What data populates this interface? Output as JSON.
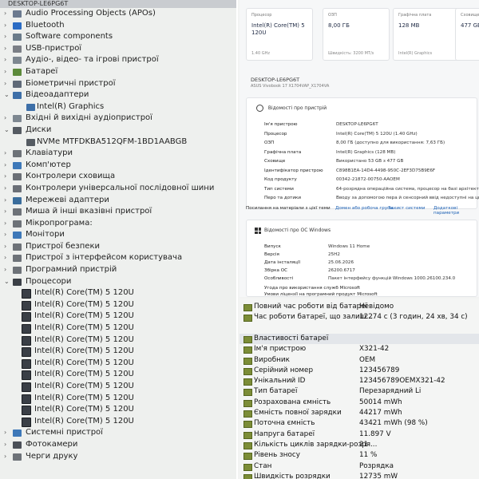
{
  "device_manager": {
    "title": "DESKTOP-LE6PG6T",
    "items": [
      {
        "label": "Audio Processing Objects (APOs)",
        "level": 0,
        "arrow": "›",
        "icon": "audio-icon",
        "color": "#6b7a8f"
      },
      {
        "label": "Bluetooth",
        "level": 0,
        "arrow": "›",
        "icon": "bluetooth-icon",
        "color": "#2b6cc4"
      },
      {
        "label": "Software components",
        "level": 0,
        "arrow": "›",
        "icon": "software-component-icon",
        "color": "#6a7b8a"
      },
      {
        "label": "USB-пристрої",
        "level": 0,
        "arrow": "›",
        "icon": "usb-icon",
        "color": "#7b7f86"
      },
      {
        "label": "Аудіо-, відео- та ігрові пристрої",
        "level": 0,
        "arrow": "›",
        "icon": "speaker-icon",
        "color": "#7d8790"
      },
      {
        "label": "Батареї",
        "level": 0,
        "arrow": "›",
        "icon": "battery-icon",
        "color": "#5c8a3a"
      },
      {
        "label": "Біометричні пристрої",
        "level": 0,
        "arrow": "›",
        "icon": "fingerprint-icon",
        "color": "#5f6a78"
      },
      {
        "label": "Відеоадаптери",
        "level": 0,
        "arrow": "⌄",
        "icon": "display-adapter-icon",
        "color": "#3d6fa8"
      },
      {
        "label": "Intel(R) Graphics",
        "level": 1,
        "arrow": "",
        "icon": "display-adapter-icon",
        "color": "#3d6fa8"
      },
      {
        "label": "Вхідні й вихідні аудіопристрої",
        "level": 0,
        "arrow": "›",
        "icon": "audio-io-icon",
        "color": "#7d8790"
      },
      {
        "label": "Диски",
        "level": 0,
        "arrow": "⌄",
        "icon": "disk-drive-icon",
        "color": "#555b62"
      },
      {
        "label": "NVMe MTFDKBA512QFM-1BD1AABGB",
        "level": 1,
        "arrow": "",
        "icon": "disk-drive-icon",
        "color": "#555b62"
      },
      {
        "label": "Клавіатури",
        "level": 0,
        "arrow": "›",
        "icon": "keyboard-icon",
        "color": "#6d7278"
      },
      {
        "label": "Комп'ютер",
        "level": 0,
        "arrow": "›",
        "icon": "computer-icon",
        "color": "#3d78b8"
      },
      {
        "label": "Контролери сховища",
        "level": 0,
        "arrow": "›",
        "icon": "storage-controller-icon",
        "color": "#6a6f76"
      },
      {
        "label": "Контролери універсальної послідовної шини",
        "level": 0,
        "arrow": "›",
        "icon": "usb-controller-icon",
        "color": "#6a6f76"
      },
      {
        "label": "Мережеві адаптери",
        "level": 0,
        "arrow": "›",
        "icon": "network-adapter-icon",
        "color": "#3a6d9c"
      },
      {
        "label": "Миша й інші вказівні пристрої",
        "level": 0,
        "arrow": "›",
        "icon": "mouse-icon",
        "color": "#6d7278"
      },
      {
        "label": "Мікропрограма:",
        "level": 0,
        "arrow": "›",
        "icon": "firmware-icon",
        "color": "#6d7278"
      },
      {
        "label": "Монітори",
        "level": 0,
        "arrow": "›",
        "icon": "monitor-icon",
        "color": "#3d78b8"
      },
      {
        "label": "Пристрої безпеки",
        "level": 0,
        "arrow": "›",
        "icon": "security-device-icon",
        "color": "#6d7278"
      },
      {
        "label": "Пристрої з інтерфейсом користувача",
        "level": 0,
        "arrow": "›",
        "icon": "hid-icon",
        "color": "#6d7278"
      },
      {
        "label": "Програмний пристрій",
        "level": 0,
        "arrow": "›",
        "icon": "software-device-icon",
        "color": "#6d7278"
      },
      {
        "label": "Процесори",
        "level": 0,
        "arrow": "⌄",
        "icon": "processor-icon",
        "color": "#3a3f46"
      },
      {
        "label": "Intel(R) Core(TM) 5 120U",
        "level": 2,
        "arrow": "",
        "icon": "processor-icon",
        "color": "#3a3f46"
      },
      {
        "label": "Intel(R) Core(TM) 5 120U",
        "level": 2,
        "arrow": "",
        "icon": "processor-icon",
        "color": "#3a3f46"
      },
      {
        "label": "Intel(R) Core(TM) 5 120U",
        "level": 2,
        "arrow": "",
        "icon": "processor-icon",
        "color": "#3a3f46"
      },
      {
        "label": "Intel(R) Core(TM) 5 120U",
        "level": 2,
        "arrow": "",
        "icon": "processor-icon",
        "color": "#3a3f46"
      },
      {
        "label": "Intel(R) Core(TM) 5 120U",
        "level": 2,
        "arrow": "",
        "icon": "processor-icon",
        "color": "#3a3f46"
      },
      {
        "label": "Intel(R) Core(TM) 5 120U",
        "level": 2,
        "arrow": "",
        "icon": "processor-icon",
        "color": "#3a3f46"
      },
      {
        "label": "Intel(R) Core(TM) 5 120U",
        "level": 2,
        "arrow": "",
        "icon": "processor-icon",
        "color": "#3a3f46"
      },
      {
        "label": "Intel(R) Core(TM) 5 120U",
        "level": 2,
        "arrow": "",
        "icon": "processor-icon",
        "color": "#3a3f46"
      },
      {
        "label": "Intel(R) Core(TM) 5 120U",
        "level": 2,
        "arrow": "",
        "icon": "processor-icon",
        "color": "#3a3f46"
      },
      {
        "label": "Intel(R) Core(TM) 5 120U",
        "level": 2,
        "arrow": "",
        "icon": "processor-icon",
        "color": "#3a3f46"
      },
      {
        "label": "Intel(R) Core(TM) 5 120U",
        "level": 2,
        "arrow": "",
        "icon": "processor-icon",
        "color": "#3a3f46"
      },
      {
        "label": "Intel(R) Core(TM) 5 120U",
        "level": 2,
        "arrow": "",
        "icon": "processor-icon",
        "color": "#3a3f46"
      },
      {
        "label": "Системні пристрої",
        "level": 0,
        "arrow": "›",
        "icon": "system-device-icon",
        "color": "#3d78b8"
      },
      {
        "label": "Фотокамери",
        "level": 0,
        "arrow": "›",
        "icon": "camera-icon",
        "color": "#4b5058"
      },
      {
        "label": "Черги друку",
        "level": 0,
        "arrow": "›",
        "icon": "printer-icon",
        "color": "#6d7278"
      }
    ]
  },
  "about": {
    "cards": [
      {
        "title": "Процесор",
        "value": "Intel(R) Core(TM) 5 120U",
        "sub": "1.40 GHz"
      },
      {
        "title": "ОЗП",
        "value": "8,00 ГБ",
        "sub": "Швидкість: 3200 MT/s"
      },
      {
        "title": "Графічна плата",
        "value": "128 MB",
        "sub": "Intel(R) Graphics"
      },
      {
        "title": "Сховище",
        "value": "477 GB",
        "sub": ""
      }
    ],
    "device_name": "DESKTOP-LE6PG6T",
    "device_model": "ASUS Vivobook 17 X1704VAP_X1704VA",
    "device_section_title": "Відомості про пристрій",
    "device_specs": [
      {
        "k": "Ім'я пристрою",
        "v": "DESKTOP-LE6PG6T"
      },
      {
        "k": "Процесор",
        "v": "Intel(R) Core(TM) 5 120U (1.40 GHz)"
      },
      {
        "k": "ОЗП",
        "v": "8,00 ГБ (доступно для використання: 7,63 ГБ)"
      },
      {
        "k": "Графічна плата",
        "v": "Intel(R) Graphics (128 MB)"
      },
      {
        "k": "Сховище",
        "v": "Використано 53 GB з 477 GB"
      },
      {
        "k": "Ідентифікатор пристрою",
        "v": "C898B1EA-14D4-4498-950C-2EF3D75B9E6F"
      },
      {
        "k": "Код продукту",
        "v": "00342-21872-00750-AAOEM"
      },
      {
        "k": "Тип системи",
        "v": "64-розрядна операційна система, процесор на базі архітектури x64"
      },
      {
        "k": "Перо та дотики",
        "v": "Вводу за допомогою пера й сенсорний ввід недоступні на цьому дисплеї"
      }
    ],
    "links": {
      "label": "Посилання на матеріали з цієї теми",
      "items": [
        "Домен або робоча група",
        "Захист системи",
        "Додаткові параметри"
      ]
    },
    "windows_section_title": "Відомості про ОС Windows",
    "windows_specs": [
      {
        "k": "Випуск",
        "v": "Windows 11 Home"
      },
      {
        "k": "Версія",
        "v": "25H2"
      },
      {
        "k": "Дата інсталяції",
        "v": "25.06.2026"
      },
      {
        "k": "Збірка ОС",
        "v": "26200.6717"
      },
      {
        "k": "Особливості",
        "v": "Пакет інтерфейсу функцій Windows 1000.26100.234.0"
      }
    ],
    "agreements": [
      "Угода про використання служб Microsoft",
      "Умови ліцензії на програмний продукт Microsoft"
    ]
  },
  "battery": {
    "rows": [
      {
        "k": "Повний час роботи від батареї",
        "v": "Невідомо",
        "icon": true,
        "hl": false
      },
      {
        "k": "Час роботи батареї, що залиш...",
        "v": "12274 с (3 годин, 24 хв, 34 с)",
        "icon": true,
        "hl": false
      },
      {
        "k": "",
        "v": "",
        "icon": false,
        "hl": false
      },
      {
        "k": "Властивості батареї",
        "v": "",
        "icon": true,
        "hl": true
      },
      {
        "k": "Ім'я пристрою",
        "v": "X321-42",
        "icon": true,
        "hl": false
      },
      {
        "k": "Виробник",
        "v": "OEM",
        "icon": true,
        "hl": false
      },
      {
        "k": "Серійний номер",
        "v": "123456789",
        "icon": true,
        "hl": false
      },
      {
        "k": "Унікальний ID",
        "v": "123456789OEMX321-42",
        "icon": true,
        "hl": false
      },
      {
        "k": "Тип батареї",
        "v": "Перезарядний Li",
        "icon": true,
        "hl": false
      },
      {
        "k": "Розрахована ємність",
        "v": "50014 mWh",
        "icon": true,
        "hl": false
      },
      {
        "k": "Ємність повної зарядки",
        "v": "44217 mWh",
        "icon": true,
        "hl": false
      },
      {
        "k": "Поточна ємність",
        "v": "43421 mWh  (98 %)",
        "icon": true,
        "hl": false
      },
      {
        "k": "Напруга батареї",
        "v": "11.897 V",
        "icon": true,
        "hl": false
      },
      {
        "k": "Кількість циклів зарядки-розря...",
        "v": "21",
        "icon": true,
        "hl": false
      },
      {
        "k": "Рівень зносу",
        "v": "11 %",
        "icon": true,
        "hl": false
      },
      {
        "k": "Стан",
        "v": "Розрядка",
        "icon": true,
        "hl": false
      },
      {
        "k": "Швидкість розрядки",
        "v": "12735 mW",
        "icon": true,
        "hl": false
      }
    ]
  }
}
